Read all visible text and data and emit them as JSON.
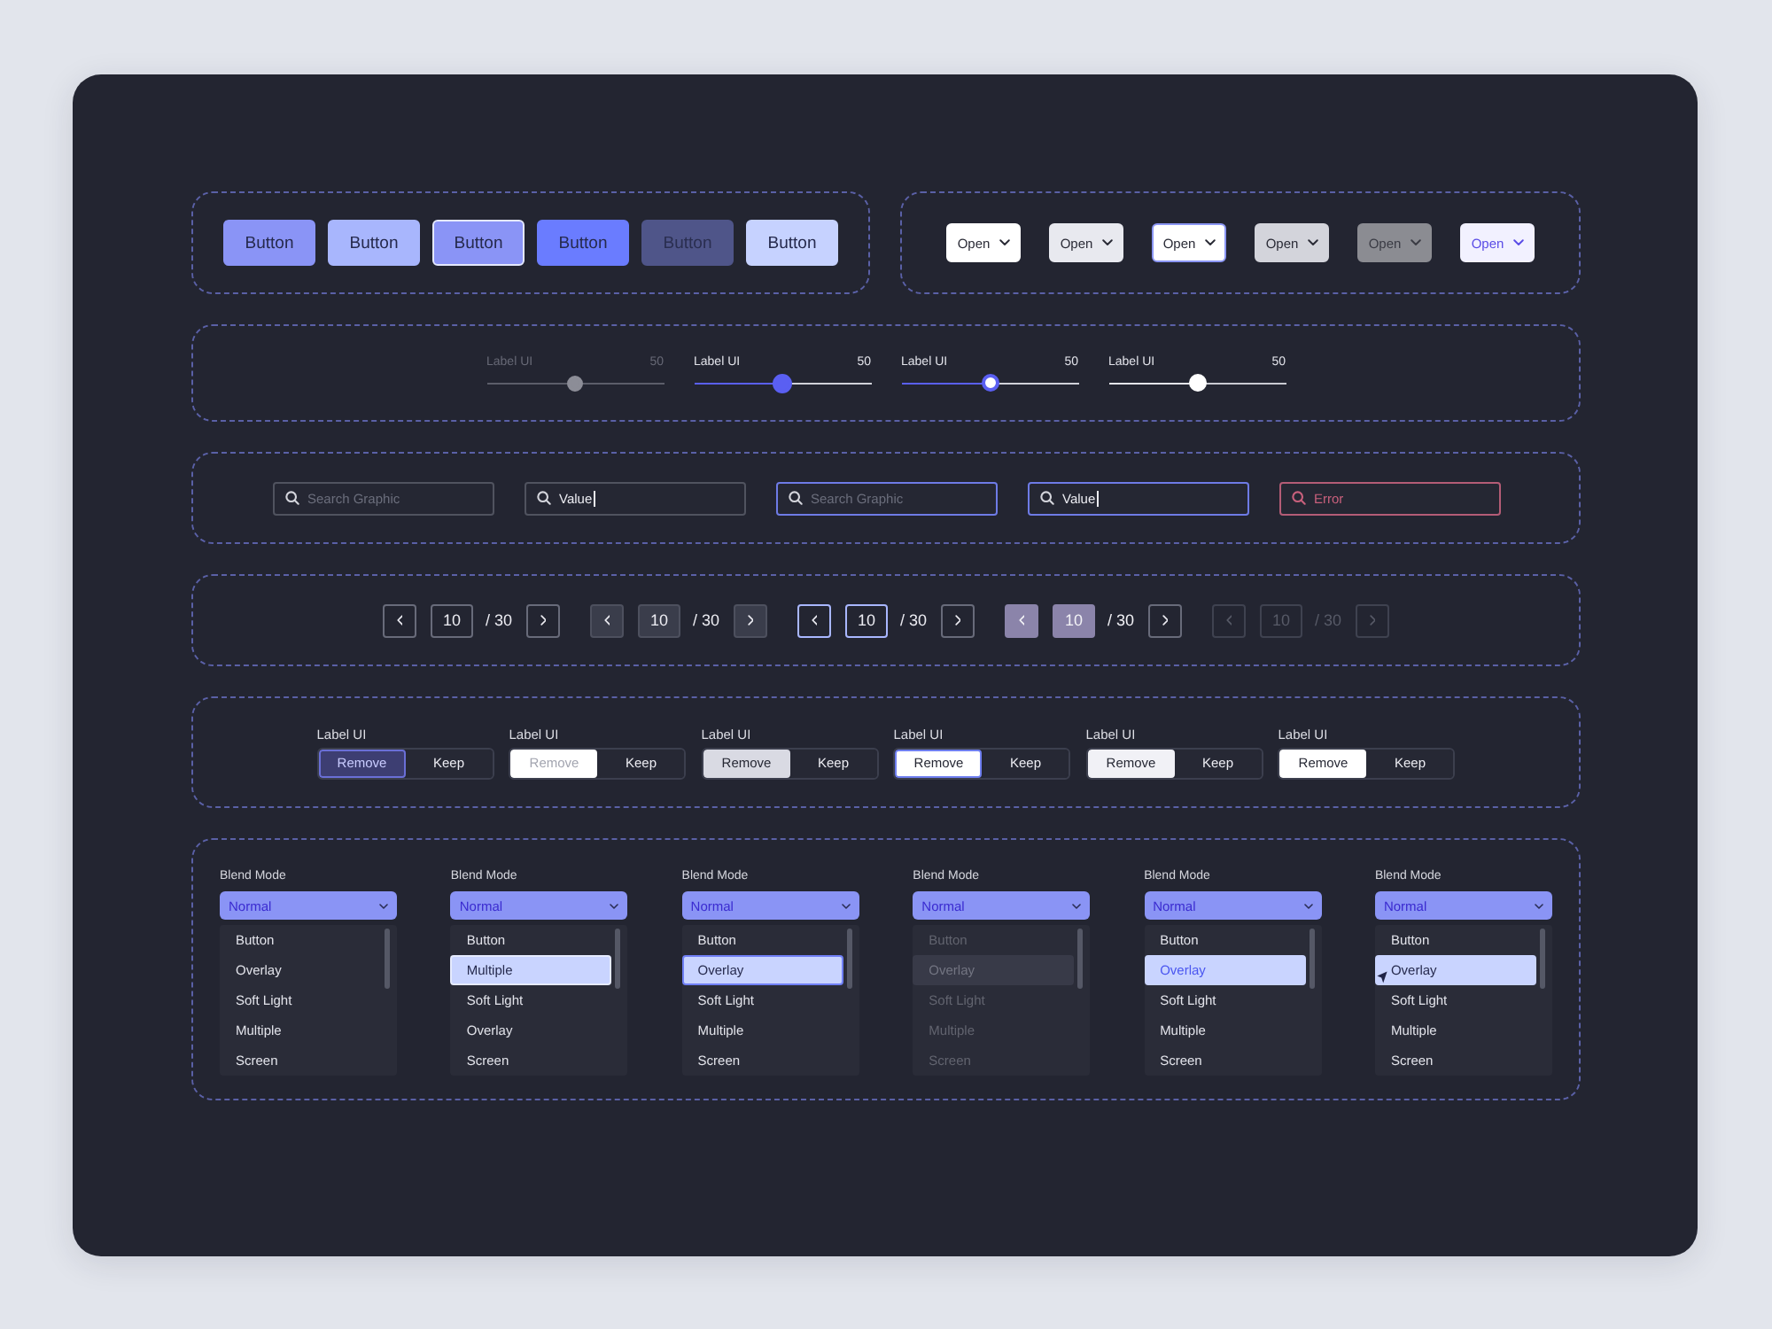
{
  "buttons": [
    {
      "label": "Button",
      "kind": "default"
    },
    {
      "label": "Button",
      "kind": "hover"
    },
    {
      "label": "Button",
      "kind": "focus"
    },
    {
      "label": "Button",
      "kind": "active"
    },
    {
      "label": "Button",
      "kind": "disabled"
    },
    {
      "label": "Button",
      "kind": "light"
    }
  ],
  "open_buttons": [
    {
      "label": "Open",
      "kind": "default"
    },
    {
      "label": "Open",
      "kind": "hover"
    },
    {
      "label": "Open",
      "kind": "focus"
    },
    {
      "label": "Open",
      "kind": "pressed"
    },
    {
      "label": "Open",
      "kind": "disabled"
    },
    {
      "label": "Open",
      "kind": "selected"
    }
  ],
  "sliders": [
    {
      "label": "Label UI",
      "reading": "50",
      "level": 0.5,
      "kind": "disabled"
    },
    {
      "label": "Label UI",
      "reading": "50",
      "level": 0.5,
      "kind": "active"
    },
    {
      "label": "Label UI",
      "reading": "50",
      "level": 0.5,
      "kind": "focus"
    },
    {
      "label": "Label UI",
      "reading": "50",
      "level": 0.5,
      "kind": "default"
    }
  ],
  "search_fields": [
    {
      "placeholder": "Search Graphic",
      "kind": "default",
      "caret": false
    },
    {
      "value": "Value",
      "kind": "default",
      "caret": true
    },
    {
      "placeholder": "Search Graphic",
      "kind": "focus",
      "caret": false
    },
    {
      "value": "Value",
      "kind": "focus",
      "caret": true
    },
    {
      "placeholder": "Error",
      "kind": "error",
      "caret": false
    }
  ],
  "paginations": [
    {
      "page": "10",
      "total": "/ 30",
      "kind": "default"
    },
    {
      "page": "10",
      "total": "/ 30",
      "kind": "hover"
    },
    {
      "page": "10",
      "total": "/ 30",
      "kind": "focus"
    },
    {
      "page": "10",
      "total": "/ 30",
      "kind": "pressed"
    },
    {
      "page": "10",
      "total": "/ 30",
      "kind": "disabled"
    }
  ],
  "segmented_controls": [
    {
      "label": "Label UI",
      "kind": "active",
      "options": [
        {
          "label": "Remove",
          "selected": true
        },
        {
          "label": "Keep",
          "selected": false
        }
      ]
    },
    {
      "label": "Label UI",
      "kind": "disabled",
      "options": [
        {
          "label": "Remove",
          "selected": true
        },
        {
          "label": "Keep",
          "selected": false
        }
      ]
    },
    {
      "label": "Label UI",
      "kind": "pressed",
      "options": [
        {
          "label": "Remove",
          "selected": true
        },
        {
          "label": "Keep",
          "selected": false
        }
      ]
    },
    {
      "label": "Label UI",
      "kind": "focus",
      "options": [
        {
          "label": "Remove",
          "selected": true
        },
        {
          "label": "Keep",
          "selected": false
        }
      ]
    },
    {
      "label": "Label UI",
      "kind": "hover",
      "options": [
        {
          "label": "Remove",
          "selected": true
        },
        {
          "label": "Keep",
          "selected": false
        }
      ]
    },
    {
      "label": "Label UI",
      "kind": "default",
      "options": [
        {
          "label": "Remove",
          "selected": true
        },
        {
          "label": "Keep",
          "selected": false
        }
      ]
    }
  ],
  "blend_mode_dropdowns": [
    {
      "label": "Blend Mode",
      "value": "Normal",
      "kind": "default",
      "items": [
        {
          "label": "Button",
          "selected": false
        },
        {
          "label": "Overlay",
          "selected": false
        },
        {
          "label": "Soft Light",
          "selected": false
        },
        {
          "label": "Multiple",
          "selected": false
        },
        {
          "label": "Screen",
          "selected": false
        }
      ]
    },
    {
      "label": "Blend Mode",
      "value": "Normal",
      "kind": "hover",
      "items": [
        {
          "label": "Button",
          "selected": false
        },
        {
          "label": "Multiple",
          "selected": true
        },
        {
          "label": "Soft Light",
          "selected": false
        },
        {
          "label": "Overlay",
          "selected": false
        },
        {
          "label": "Screen",
          "selected": false
        }
      ]
    },
    {
      "label": "Blend Mode",
      "value": "Normal",
      "kind": "focus",
      "items": [
        {
          "label": "Button",
          "selected": false
        },
        {
          "label": "Overlay",
          "selected": true
        },
        {
          "label": "Soft Light",
          "selected": false
        },
        {
          "label": "Multiple",
          "selected": false
        },
        {
          "label": "Screen",
          "selected": false
        }
      ]
    },
    {
      "label": "Blend Mode",
      "value": "Normal",
      "kind": "disabled",
      "items": [
        {
          "label": "Button",
          "selected": false
        },
        {
          "label": "Overlay",
          "selected": true
        },
        {
          "label": "Soft Light",
          "selected": false
        },
        {
          "label": "Multiple",
          "selected": false
        },
        {
          "label": "Screen",
          "selected": false
        }
      ]
    },
    {
      "label": "Blend Mode",
      "value": "Normal",
      "kind": "selected",
      "items": [
        {
          "label": "Button",
          "selected": false
        },
        {
          "label": "Overlay",
          "selected": true
        },
        {
          "label": "Soft Light",
          "selected": false
        },
        {
          "label": "Multiple",
          "selected": false
        },
        {
          "label": "Screen",
          "selected": false
        }
      ]
    },
    {
      "label": "Blend Mode",
      "value": "Normal",
      "kind": "pointer",
      "items": [
        {
          "label": "Button",
          "selected": false
        },
        {
          "label": "Overlay",
          "selected": true
        },
        {
          "label": "Soft Light",
          "selected": false
        },
        {
          "label": "Multiple",
          "selected": false
        },
        {
          "label": "Screen",
          "selected": false
        }
      ]
    }
  ]
}
